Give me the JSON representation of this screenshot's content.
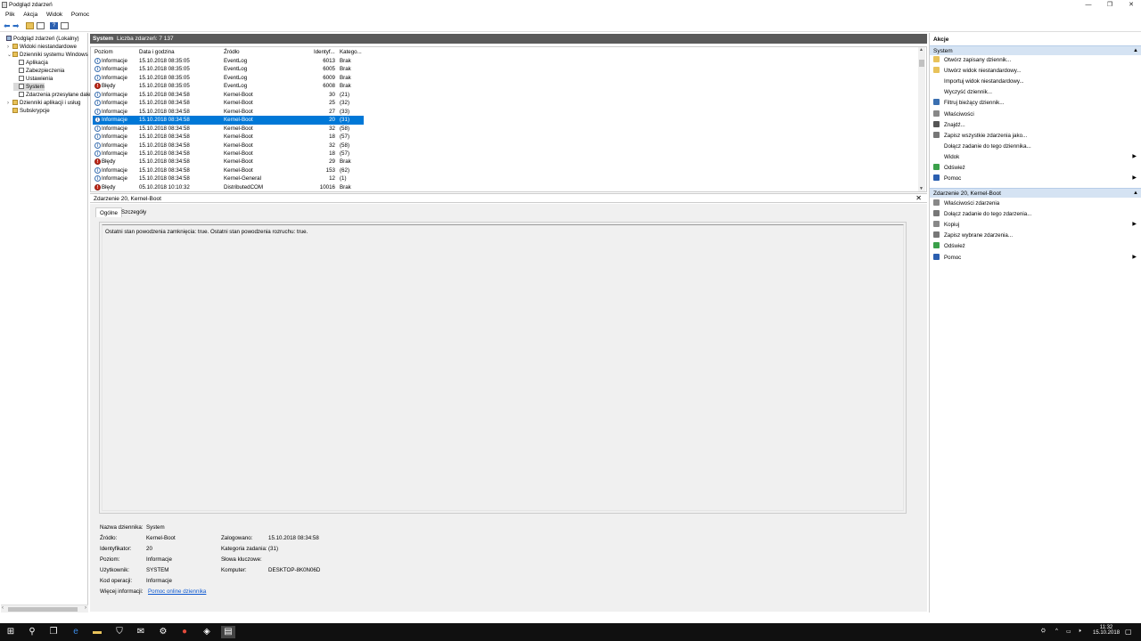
{
  "window": {
    "title": "Podgląd zdarzeń"
  },
  "menu": [
    "Plik",
    "Akcja",
    "Widok",
    "Pomoc"
  ],
  "tree": [
    {
      "label": "Podgląd zdarzeń (Lokalny)",
      "indent": 0,
      "icon": "pc",
      "exp": ""
    },
    {
      "label": "Widoki niestandardowe",
      "indent": 1,
      "icon": "folder",
      "exp": "›"
    },
    {
      "label": "Dzienniki systemu Windows",
      "indent": 1,
      "icon": "folder",
      "exp": "⌄"
    },
    {
      "label": "Aplikacja",
      "indent": 2,
      "icon": "log",
      "exp": ""
    },
    {
      "label": "Zabezpieczenia",
      "indent": 2,
      "icon": "log",
      "exp": ""
    },
    {
      "label": "Ustawienia",
      "indent": 2,
      "icon": "log",
      "exp": ""
    },
    {
      "label": "System",
      "indent": 2,
      "icon": "log",
      "exp": "",
      "selected": true
    },
    {
      "label": "Zdarzenia przesyłane dalej",
      "indent": 2,
      "icon": "log",
      "exp": ""
    },
    {
      "label": "Dzienniki aplikacji i usług",
      "indent": 1,
      "icon": "folder",
      "exp": "›"
    },
    {
      "label": "Subskrypcje",
      "indent": 1,
      "icon": "folder",
      "exp": ""
    }
  ],
  "list_header": {
    "log_name": "System",
    "count_label": "Liczba zdarzeń: 7 137"
  },
  "columns": [
    "Poziom",
    "Data i godzina",
    "Źródło",
    "Identyf...",
    "Katego..."
  ],
  "events": [
    {
      "level": "Informacje",
      "type": "info",
      "datetime": "15.10.2018 08:35:05",
      "source": "EventLog",
      "id": "6013",
      "category": "Brak"
    },
    {
      "level": "Informacje",
      "type": "info",
      "datetime": "15.10.2018 08:35:05",
      "source": "EventLog",
      "id": "6005",
      "category": "Brak"
    },
    {
      "level": "Informacje",
      "type": "info",
      "datetime": "15.10.2018 08:35:05",
      "source": "EventLog",
      "id": "6009",
      "category": "Brak"
    },
    {
      "level": "Błędy",
      "type": "err",
      "datetime": "15.10.2018 08:35:05",
      "source": "EventLog",
      "id": "6008",
      "category": "Brak"
    },
    {
      "level": "Informacje",
      "type": "info",
      "datetime": "15.10.2018 08:34:58",
      "source": "Kernel-Boot",
      "id": "30",
      "category": "(21)"
    },
    {
      "level": "Informacje",
      "type": "info",
      "datetime": "15.10.2018 08:34:58",
      "source": "Kernel-Boot",
      "id": "25",
      "category": "(32)"
    },
    {
      "level": "Informacje",
      "type": "info",
      "datetime": "15.10.2018 08:34:58",
      "source": "Kernel-Boot",
      "id": "27",
      "category": "(33)"
    },
    {
      "level": "Informacje",
      "type": "info",
      "datetime": "15.10.2018 08:34:58",
      "source": "Kernel-Boot",
      "id": "20",
      "category": "(31)",
      "selected": true
    },
    {
      "level": "Informacje",
      "type": "info",
      "datetime": "15.10.2018 08:34:58",
      "source": "Kernel-Boot",
      "id": "32",
      "category": "(58)"
    },
    {
      "level": "Informacje",
      "type": "info",
      "datetime": "15.10.2018 08:34:58",
      "source": "Kernel-Boot",
      "id": "18",
      "category": "(57)"
    },
    {
      "level": "Informacje",
      "type": "info",
      "datetime": "15.10.2018 08:34:58",
      "source": "Kernel-Boot",
      "id": "32",
      "category": "(58)"
    },
    {
      "level": "Informacje",
      "type": "info",
      "datetime": "15.10.2018 08:34:58",
      "source": "Kernel-Boot",
      "id": "18",
      "category": "(57)"
    },
    {
      "level": "Błędy",
      "type": "err",
      "datetime": "15.10.2018 08:34:58",
      "source": "Kernel-Boot",
      "id": "29",
      "category": "Brak"
    },
    {
      "level": "Informacje",
      "type": "info",
      "datetime": "15.10.2018 08:34:58",
      "source": "Kernel-Boot",
      "id": "153",
      "category": "(62)"
    },
    {
      "level": "Informacje",
      "type": "info",
      "datetime": "15.10.2018 08:34:58",
      "source": "Kernel-General",
      "id": "12",
      "category": "(1)"
    },
    {
      "level": "Błędy",
      "type": "err",
      "datetime": "05.10.2018 10:10:32",
      "source": "DistributedCOM",
      "id": "10016",
      "category": "Brak"
    }
  ],
  "detail": {
    "title": "Zdarzenie 20, Kernel-Boot",
    "tabs": [
      "Ogólne",
      "Szczegóły"
    ],
    "description": "Ostatni stan powodzenia zamknięcia: true. Ostatni stan powodzenia rozruchu: true.",
    "props_left": [
      {
        "label": "Nazwa dziennika:",
        "value": "System"
      },
      {
        "label": "Źródło:",
        "value": "Kernel-Boot"
      },
      {
        "label": "Identyfikator:",
        "value": "20"
      },
      {
        "label": "Poziom:",
        "value": "Informacje"
      },
      {
        "label": "Użytkownik:",
        "value": "SYSTEM"
      },
      {
        "label": "Kod operacji:",
        "value": "Informacje"
      },
      {
        "label": "Więcej informacji:",
        "value": "Pomoc online dziennika"
      }
    ],
    "props_right": [
      {
        "label": "Zalogowano:",
        "value": "15.10.2018 08:34:58"
      },
      {
        "label": "Kategoria zadania:",
        "value": "(31)"
      },
      {
        "label": "Słowa kluczowe:",
        "value": ""
      },
      {
        "label": "Komputer:",
        "value": "DESKTOP-8K0N06D"
      }
    ]
  },
  "actions": {
    "title": "Akcje",
    "section1": "System",
    "items1": [
      {
        "label": "Otwórz zapisany dziennik...",
        "icon": "folder-open-icon",
        "color": "#e8c25a"
      },
      {
        "label": "Utwórz widok niestandardowy...",
        "icon": "filter-new-icon",
        "color": "#e8c25a"
      },
      {
        "label": "Importuj widok niestandardowy...",
        "icon": "",
        "color": ""
      },
      {
        "label": "Wyczyść dziennik...",
        "icon": "",
        "color": ""
      },
      {
        "label": "Filtruj bieżący dziennik...",
        "icon": "filter-icon",
        "color": "#3a6fb0"
      },
      {
        "label": "Właściwości",
        "icon": "properties-icon",
        "color": "#888888"
      },
      {
        "label": "Znajdź...",
        "icon": "find-icon",
        "color": "#555555"
      },
      {
        "label": "Zapisz wszystkie zdarzenia jako...",
        "icon": "save-icon",
        "color": "#777777"
      },
      {
        "label": "Dołącz zadanie do tego dziennika...",
        "icon": "",
        "color": ""
      },
      {
        "label": "Widok",
        "icon": "",
        "color": "",
        "submenu": true
      },
      {
        "label": "Odśwież",
        "icon": "refresh-icon",
        "color": "#3aa04a"
      },
      {
        "label": "Pomoc",
        "icon": "help-icon",
        "color": "#2b5fb0",
        "submenu": true
      }
    ],
    "section2": "Zdarzenie 20, Kernel-Boot",
    "items2": [
      {
        "label": "Właściwości zdarzenia",
        "icon": "event-properties-icon",
        "color": "#888888"
      },
      {
        "label": "Dołącz zadanie do tego zdarzenia...",
        "icon": "attach-task-icon",
        "color": "#777777"
      },
      {
        "label": "Kopiuj",
        "icon": "copy-icon",
        "color": "#888888",
        "submenu": true
      },
      {
        "label": "Zapisz wybrane zdarzenia...",
        "icon": "save-icon",
        "color": "#777777"
      },
      {
        "label": "Odśwież",
        "icon": "refresh-icon",
        "color": "#3aa04a"
      },
      {
        "label": "Pomoc",
        "icon": "help-icon",
        "color": "#2b5fb0",
        "submenu": true
      }
    ]
  },
  "taskbar": {
    "time": "11:32",
    "date": "15.10.2018"
  }
}
